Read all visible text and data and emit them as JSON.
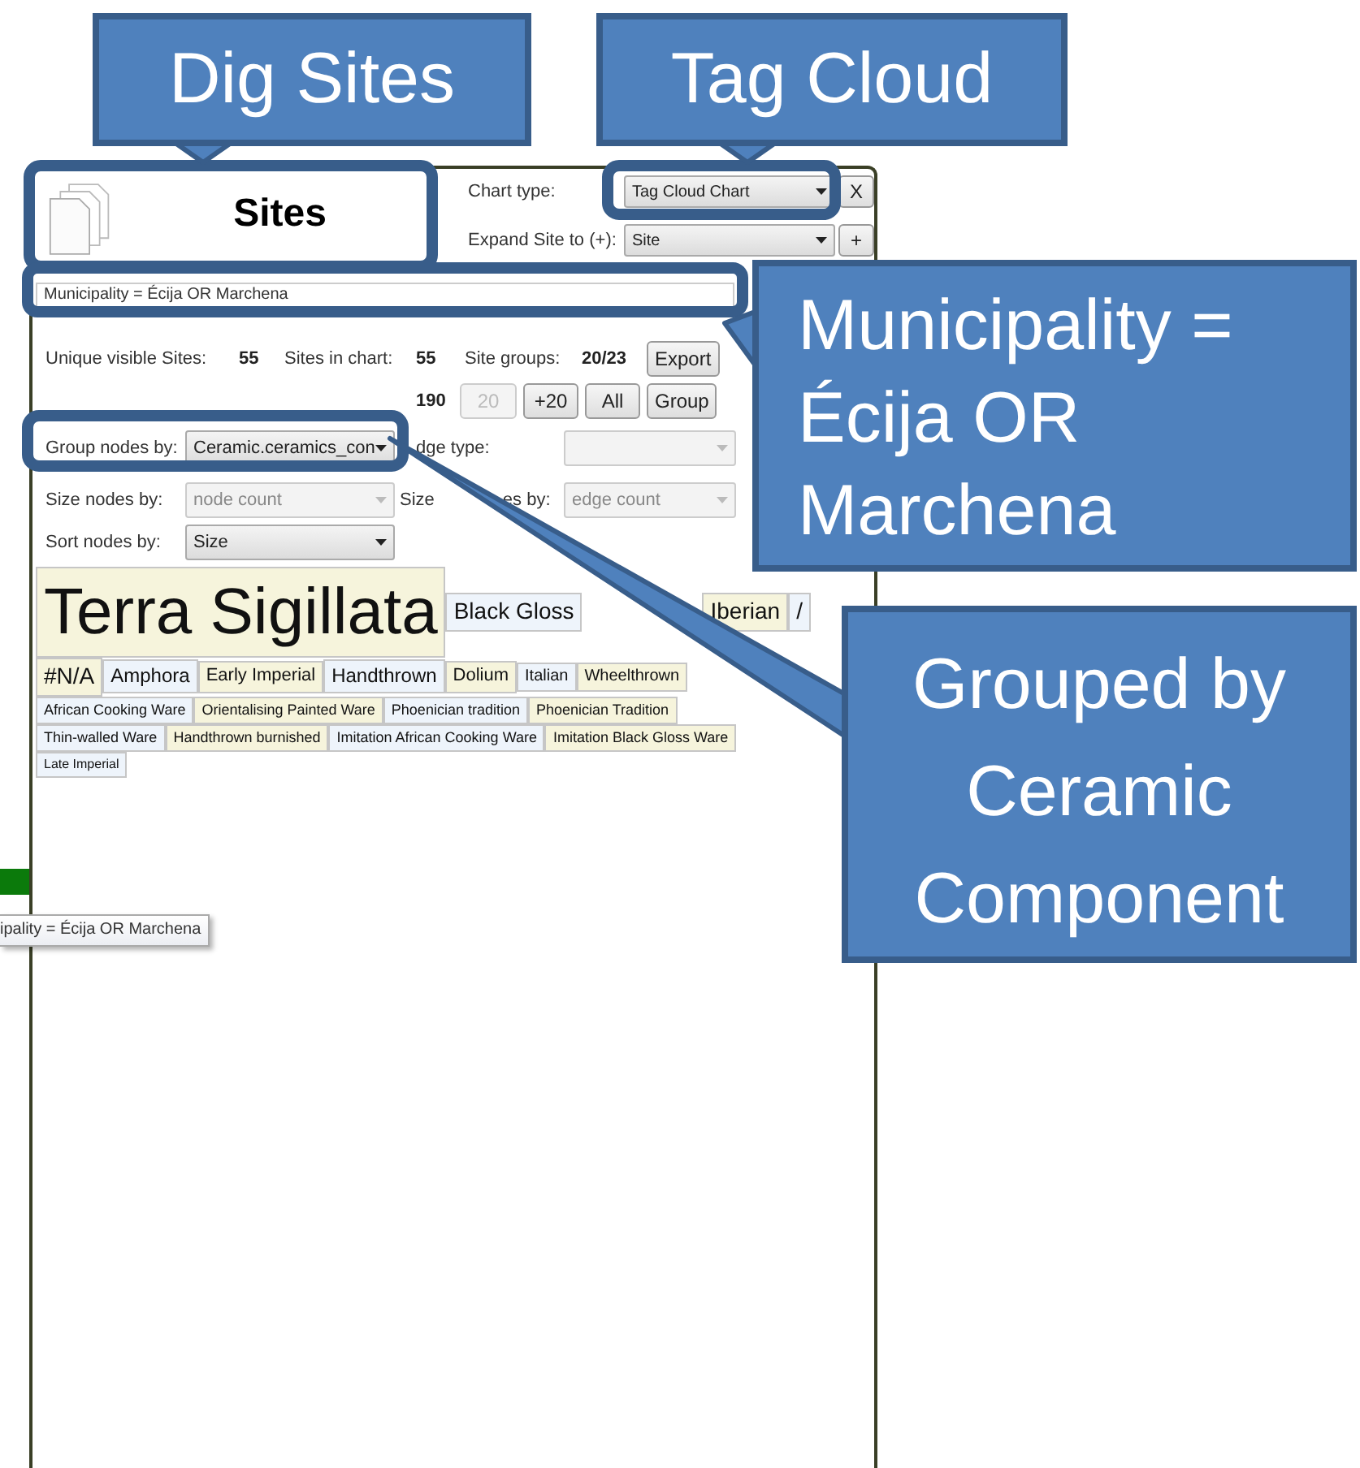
{
  "callouts": [
    {
      "text": "Dig Sites"
    },
    {
      "text": "Tag Cloud"
    },
    {
      "text": "Municipality = Écija OR Marchena"
    },
    {
      "text": "Grouped by Ceramic Component"
    }
  ],
  "header": {
    "title": "Sites",
    "chart_type_label": "Chart type:",
    "chart_type": "Tag Cloud Chart",
    "close": "X",
    "expand_label": "Expand Site to (+):",
    "expand_value": "Site",
    "expand_button": "+"
  },
  "filter": {
    "value": "Municipality = Écija OR Marchena"
  },
  "stats": [
    {
      "label": "Unique visible Sites:",
      "value": "55"
    },
    {
      "label": "Sites in chart:",
      "value": "55"
    },
    {
      "label": "Site groups:",
      "value": "20/23"
    }
  ],
  "stats2_value": "190",
  "buttons_row1": [
    {
      "label": "Export",
      "disabled": false
    }
  ],
  "buttons_row2": [
    {
      "label": "20",
      "disabled": true
    },
    {
      "label": "+20",
      "disabled": false
    },
    {
      "label": "All",
      "disabled": false
    },
    {
      "label": "Group",
      "disabled": false
    }
  ],
  "option_rows": [
    [
      {
        "label": "Group nodes by:",
        "value": "Ceramic.ceramics_con",
        "disabled": false
      },
      {
        "label_parts": [
          "dge type:"
        ],
        "disabled": true
      }
    ],
    [
      {
        "label": "Size nodes by:",
        "value": "node count",
        "disabled": true
      },
      {
        "label_parts": [
          "Size",
          "es by:"
        ],
        "value": "edge count",
        "disabled": true
      }
    ],
    [
      {
        "label": "Sort nodes by:",
        "value": "Size",
        "disabled": false
      }
    ]
  ],
  "tag_rows": [
    [
      {
        "text": "Terra Sigillata",
        "kind": "huge",
        "color": "#f6f4dc"
      },
      {
        "text": "Black Gloss",
        "kind": "medium",
        "color": "#eef4fb"
      },
      {
        "text": "Iberian",
        "kind": "medium",
        "color": "#f6f4dc"
      },
      {
        "text": "/",
        "kind": "medium",
        "color": "#eef4fb"
      }
    ],
    [
      {
        "text": "#N/A",
        "kind": "medium",
        "color": "#f6f4dc"
      },
      {
        "text": "Amphora",
        "kind": "small",
        "color": "#eef4fb"
      },
      {
        "text": "Early Imperial",
        "kind": "xsmall",
        "color": "#f6f4dc"
      },
      {
        "text": "Handthrown",
        "kind": "small",
        "color": "#eef4fb"
      },
      {
        "text": "Dolium",
        "kind": "xsmall",
        "color": "#f6f4dc"
      },
      {
        "text": "Italian",
        "kind": "tiny",
        "color": "#eef4fb"
      },
      {
        "text": "Wheelthrown",
        "kind": "tiny",
        "color": "#f6f4dc"
      }
    ],
    [
      {
        "text": "African Cooking Ware",
        "kind": "micro",
        "color": "#eef4fb"
      },
      {
        "text": "Orientalising Painted Ware",
        "kind": "micro",
        "color": "#f6f4dc"
      },
      {
        "text": "Phoenician tradition",
        "kind": "micro",
        "color": "#eef4fb"
      },
      {
        "text": "Phoenician Tradition",
        "kind": "micro",
        "color": "#f6f4dc"
      }
    ],
    [
      {
        "text": "Thin-walled Ware",
        "kind": "micro",
        "color": "#eef4fb"
      },
      {
        "text": "Handthrown burnished",
        "kind": "micro",
        "color": "#f6f4dc"
      },
      {
        "text": "Imitation African Cooking Ware",
        "kind": "micro",
        "color": "#eef4fb"
      },
      {
        "text": "Imitation Black Gloss Ware",
        "kind": "micro",
        "color": "#f6f4dc"
      }
    ],
    [
      {
        "text": "Late Imperial",
        "kind": "nano",
        "color": "#eef4fb"
      }
    ]
  ],
  "tooltip": {
    "text": "ipality = Écija OR Marchena"
  }
}
